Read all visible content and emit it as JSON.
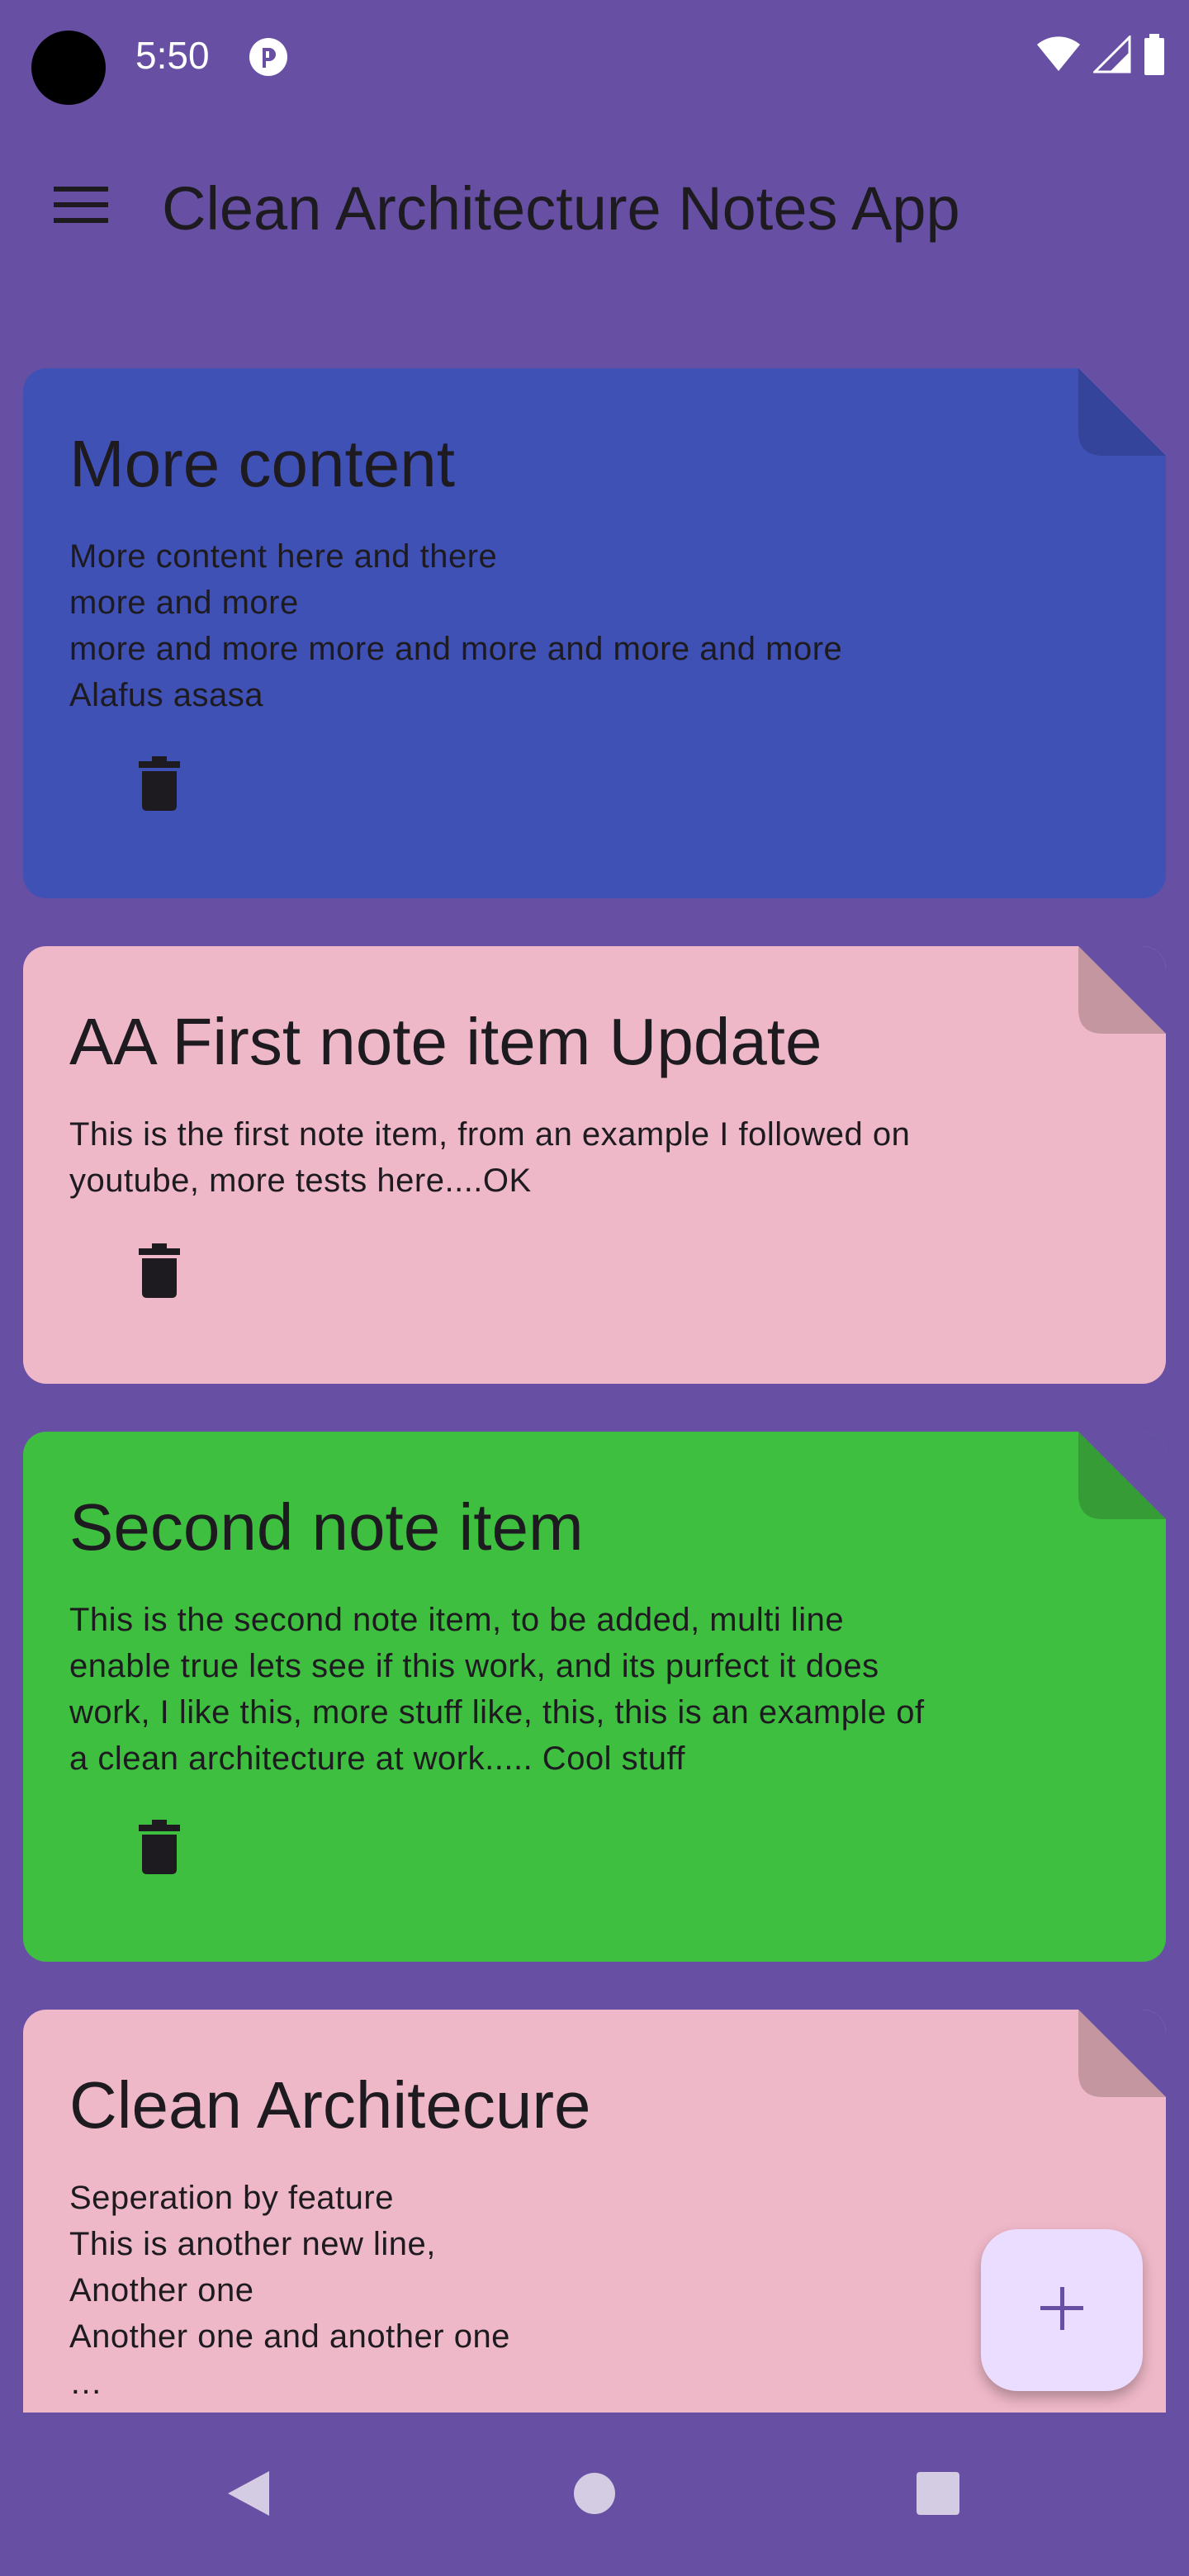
{
  "status_bar": {
    "time": "5:50",
    "icons": [
      "camera-cutout",
      "notification-icon",
      "wifi-icon",
      "signal-icon",
      "battery-icon"
    ]
  },
  "app_bar": {
    "title": "Clean Architecture Notes App",
    "menu_icon": "menu-icon"
  },
  "notes": [
    {
      "title": "More content",
      "content": "More content here and there\nmore and more\nmore and more more and more and more and more\nAlafus asasa",
      "color": "#3F51B5",
      "fold_color": "#34449A",
      "delete_icon": "trash-icon"
    },
    {
      "title": "AA First note item Update",
      "content": "This is the first note item, from an example I followed on\nyoutube, more tests here....OK",
      "color": "#EFB8C8",
      "fold_color": "#C4969F",
      "delete_icon": "trash-icon"
    },
    {
      "title": "Second note item",
      "content": "This is the second note item, to be added, multi line\nenable true lets see if this work, and its purfect it does\nwork, I like this, more stuff like, this, this is an example of\na clean architecture at work..... Cool stuff",
      "color": "#3FBF3F",
      "fold_color": "#369C36",
      "delete_icon": "trash-icon"
    },
    {
      "title": "Clean Architecure",
      "content": "Seperation by feature\nThis is another new line,\nAnother one\nAnother one and another one\n…",
      "color": "#EFB8C8",
      "fold_color": "#C4969F",
      "delete_icon": "trash-icon"
    }
  ],
  "fab": {
    "icon": "add-icon",
    "color": "#EADDFF"
  },
  "nav_bar": {
    "back_icon": "back-icon",
    "home_icon": "home-icon",
    "recents_icon": "recents-icon"
  },
  "colors": {
    "background": "#6750A4",
    "on_surface": "#1D1B20",
    "nav_icon": "#D3CCE3"
  }
}
